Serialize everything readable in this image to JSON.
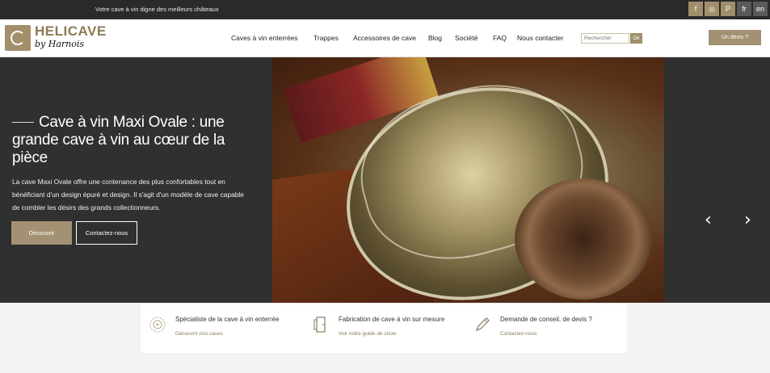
{
  "topbar": {
    "tagline": "Votre cave à vin digne des meilleurs châteaux",
    "social": [
      "f",
      "◎",
      "P",
      "fr",
      "en"
    ]
  },
  "header": {
    "brand": "HELICAVE",
    "brand_sub": "by Harnois",
    "nav": [
      "Caves à vin enterrées",
      "Trappes",
      "Accessoires de cave",
      "Blog",
      "Société",
      "FAQ",
      "Nous contacter"
    ],
    "search_placeholder": "Rechercher",
    "search_button": "Ok",
    "devis_button": "Un devis ?"
  },
  "hero": {
    "title": "Cave à vin Maxi Ovale : une grande cave à vin au cœur de la pièce",
    "description": "La cave Maxi Ovale offre une contenance des plus confortables tout en bénéficiant d'un design épuré et design. Il s'agit d'un modèle de cave capable de combler les désirs des grands collectionneurs.",
    "primary_button": "Découvrir",
    "secondary_button": "Contactez-nous",
    "prev": "‹",
    "next": "›"
  },
  "features": [
    {
      "title": "Spécialiste de la cave à vin enterrée",
      "link": "Découvrir nos caves",
      "icon": "spiral-icon"
    },
    {
      "title": "Fabrication de cave à vin sur mesure",
      "link": "Voir notre guide de choix",
      "icon": "door-icon"
    },
    {
      "title": "Demande de conseil, de devis ?",
      "link": "Contactez-nous",
      "icon": "pencil-icon"
    }
  ],
  "colors": {
    "accent": "#a39173",
    "dark": "#2a2a2a"
  }
}
